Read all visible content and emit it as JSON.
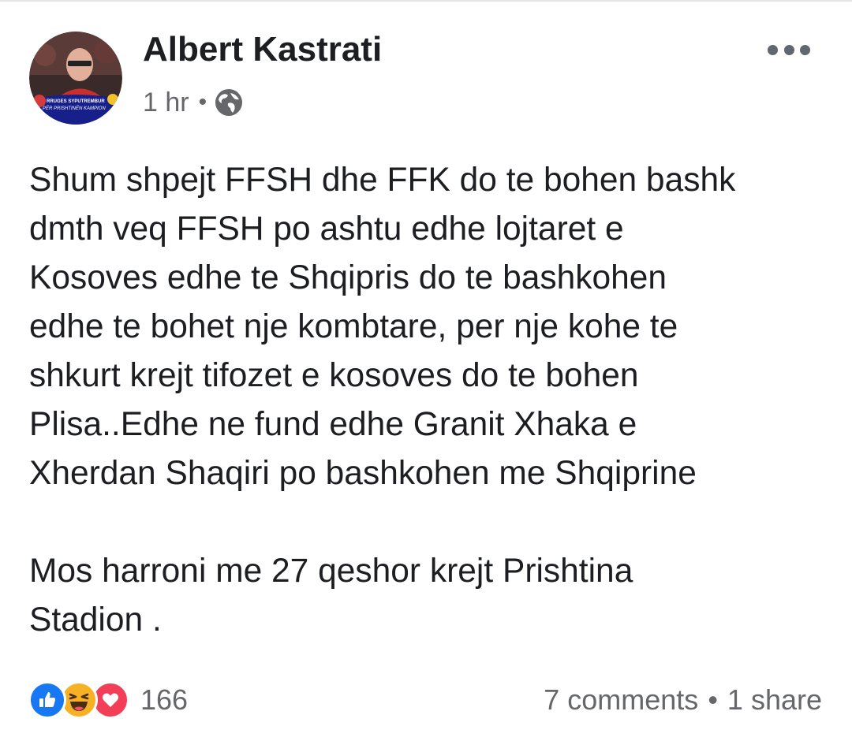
{
  "post": {
    "author": "Albert Kastrati",
    "time": "1 hr",
    "time_separator": "•",
    "privacy_icon": "globe-icon",
    "avatar_text": [
      "RRUGES SYPUTREMBUR",
      "PËR PRISHTINËN KAMPION"
    ],
    "lines": [
      "Shum shpejt  FFSH dhe FFK do te bohen bashk",
      "dmth veq FFSH po ashtu edhe lojtaret e",
      "Kosoves edhe te Shqipris do te bashkohen",
      "edhe te bohet nje kombtare, per nje kohe te",
      "shkurt krejt tifozet e kosoves do te bohen",
      "Plisa..Edhe ne fund edhe Granit Xhaka e",
      "Xherdan Shaqiri po bashkohen me Shqiprine",
      "Mos harroni me 27 qeshor krejt Prishtina",
      "Stadion ."
    ]
  },
  "footer": {
    "reaction_icons": [
      "like-icon",
      "haha-icon",
      "love-icon"
    ],
    "reaction_count": "166",
    "comments": "7 comments",
    "separator": "•",
    "shares": "1 share"
  },
  "colors": {
    "text": "#1c1e21",
    "secondary": "#65676b",
    "like": "#1877f2",
    "haha": "#f7b125",
    "love": "#f33e58"
  }
}
